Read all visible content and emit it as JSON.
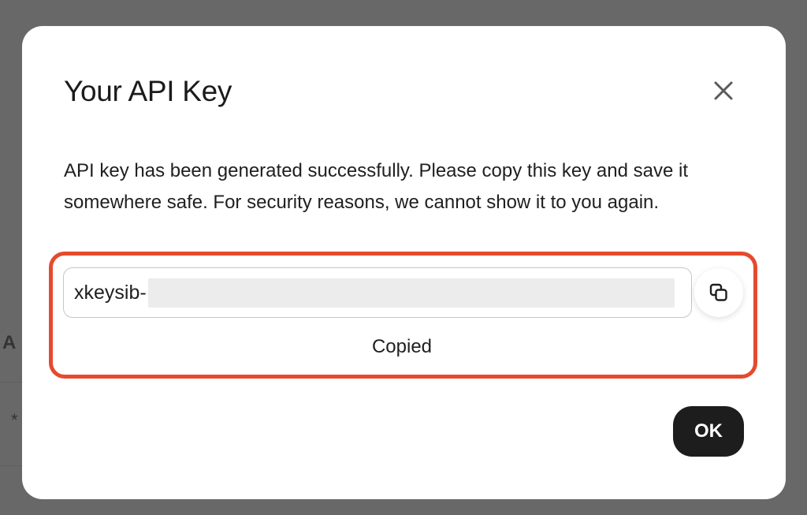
{
  "backdrop": {
    "fragment_a": "A",
    "fragment_b": "*"
  },
  "modal": {
    "title": "Your API Key",
    "close_icon": "close-icon",
    "message": "API key has been generated successfully. Please copy this key and save it somewhere safe. For security reasons, we cannot show it to you again.",
    "key_field": {
      "visible_prefix": "xkeysib-",
      "value_redacted": true
    },
    "copy_icon": "copy-icon",
    "status_text": "Copied",
    "ok_label": "OK"
  },
  "colors": {
    "highlight_border": "#e64a2e",
    "ok_button_bg": "#1d1d1d",
    "overlay": "#686868",
    "redaction": "#ececec"
  }
}
